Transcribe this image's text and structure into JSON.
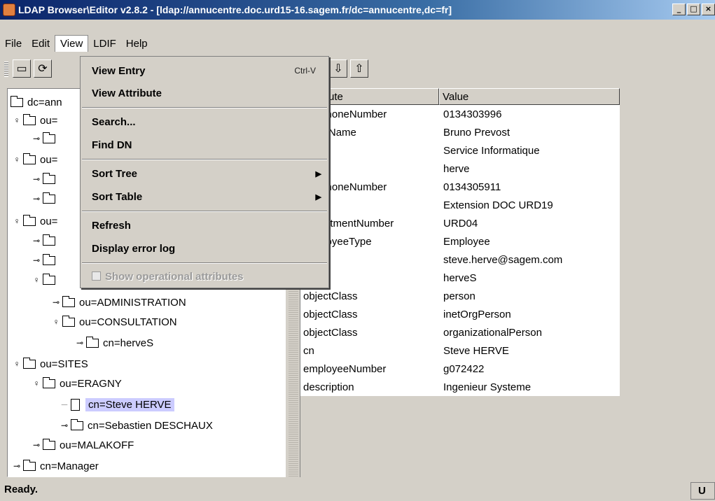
{
  "window": {
    "title": "LDAP Browser\\Editor v2.8.2 - [ldap://annucentre.doc.urd15-16.sagem.fr/dc=annucentre,dc=fr]"
  },
  "menubar": [
    "File",
    "Edit",
    "View",
    "LDIF",
    "Help"
  ],
  "view_menu": {
    "items": [
      {
        "label": "View Entry",
        "shortcut": "Ctrl-V"
      },
      {
        "label": "View Attribute"
      },
      {
        "label": "Search..."
      },
      {
        "label": "Find DN"
      },
      {
        "label": "Sort Tree"
      },
      {
        "label": "Sort Table"
      },
      {
        "label": "Refresh"
      },
      {
        "label": "Display error log"
      },
      {
        "label": "Show operational attributes",
        "disabled": true
      }
    ]
  },
  "tree": [
    {
      "label": "dc=ann"
    },
    {
      "label": "ou="
    },
    {
      "label": ""
    },
    {
      "label": "ou="
    },
    {
      "label": ""
    },
    {
      "label": ""
    },
    {
      "label": "ou="
    },
    {
      "label": ""
    },
    {
      "label": ""
    },
    {
      "label": ""
    },
    {
      "label": "ou=ADMINISTRATION"
    },
    {
      "label": "ou=CONSULTATION"
    },
    {
      "label": "cn=herveS"
    },
    {
      "label": "ou=SITES"
    },
    {
      "label": "ou=ERAGNY"
    },
    {
      "label": "cn=Steve HERVE",
      "selected": true
    },
    {
      "label": "cn=Sebastien DESCHAUX"
    },
    {
      "label": "ou=MALAKOFF"
    },
    {
      "label": "cn=Manager"
    }
  ],
  "table": {
    "columns": [
      "Attribute",
      "Value"
    ],
    "rows": [
      [
        "telephoneNumber",
        "0134303996"
      ],
      [
        "givenName",
        "Bruno Prevost"
      ],
      [
        "",
        "Service Informatique"
      ],
      [
        "",
        "herve"
      ],
      [
        "telephoneNumber",
        "0134305911"
      ],
      [
        "",
        "Extension DOC URD19"
      ],
      [
        "departmentNumber",
        "URD04"
      ],
      [
        "employeeType",
        "Employee"
      ],
      [
        "",
        "steve.herve@sagem.com"
      ],
      [
        "",
        "herveS"
      ],
      [
        "objectClass",
        "person"
      ],
      [
        "objectClass",
        "inetOrgPerson"
      ],
      [
        "objectClass",
        "organizationalPerson"
      ],
      [
        "cn",
        "Steve HERVE"
      ],
      [
        "employeeNumber",
        "g072422"
      ],
      [
        "description",
        "Ingenieur Systeme"
      ]
    ]
  },
  "status": {
    "text": "Ready.",
    "right": "U"
  }
}
